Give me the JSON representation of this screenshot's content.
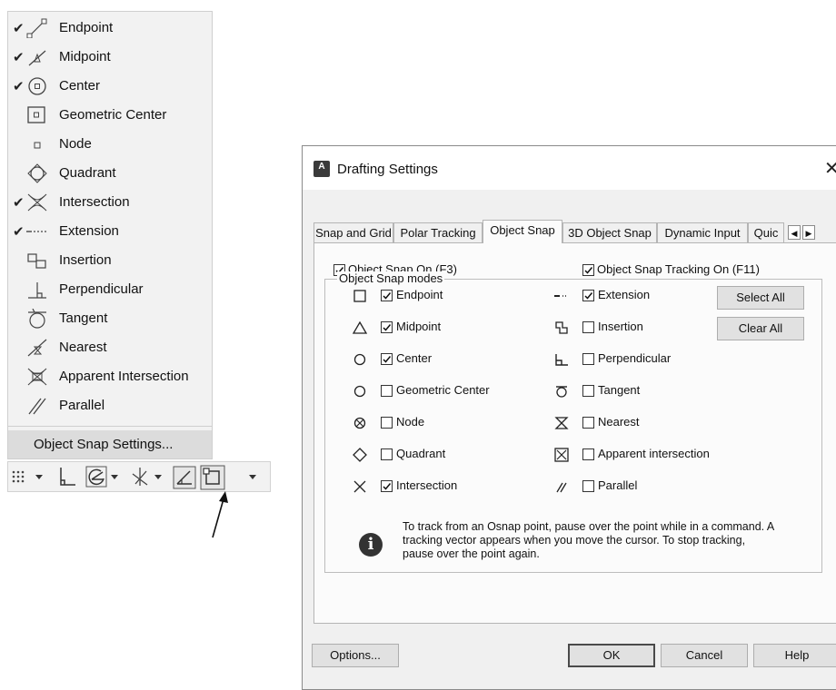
{
  "menu": {
    "items": [
      {
        "label": "Endpoint",
        "checked": true,
        "icon": "endpoint-icon"
      },
      {
        "label": "Midpoint",
        "checked": true,
        "icon": "midpoint-icon"
      },
      {
        "label": "Center",
        "checked": true,
        "icon": "center-icon"
      },
      {
        "label": "Geometric Center",
        "checked": false,
        "icon": "geometric-center-icon"
      },
      {
        "label": "Node",
        "checked": false,
        "icon": "node-icon"
      },
      {
        "label": "Quadrant",
        "checked": false,
        "icon": "quadrant-icon"
      },
      {
        "label": "Intersection",
        "checked": true,
        "icon": "intersection-icon"
      },
      {
        "label": "Extension",
        "checked": true,
        "icon": "extension-icon"
      },
      {
        "label": "Insertion",
        "checked": false,
        "icon": "insertion-icon"
      },
      {
        "label": "Perpendicular",
        "checked": false,
        "icon": "perpendicular-icon"
      },
      {
        "label": "Tangent",
        "checked": false,
        "icon": "tangent-icon"
      },
      {
        "label": "Nearest",
        "checked": false,
        "icon": "nearest-icon"
      },
      {
        "label": "Apparent Intersection",
        "checked": false,
        "icon": "apparent-intersection-icon"
      },
      {
        "label": "Parallel",
        "checked": false,
        "icon": "parallel-icon"
      }
    ],
    "settings_label": "Object Snap Settings...",
    "check_glyph": "✔"
  },
  "dialog": {
    "title": "Drafting Settings",
    "close": "✕",
    "app_icon": "A",
    "tabs": [
      "Snap and Grid",
      "Polar Tracking",
      "Object Snap",
      "3D Object Snap",
      "Dynamic Input",
      "Quic"
    ],
    "active_tab": "Object Snap",
    "osnap_on": {
      "label": "Object Snap On (F3)",
      "checked": true
    },
    "tracking_on": {
      "label": "Object Snap Tracking On (F11)",
      "checked": true
    },
    "group_title": "Object Snap modes",
    "modes_left": [
      {
        "label": "Endpoint",
        "checked": true
      },
      {
        "label": "Midpoint",
        "checked": true
      },
      {
        "label": "Center",
        "checked": true
      },
      {
        "label": "Geometric Center",
        "checked": false
      },
      {
        "label": "Node",
        "checked": false
      },
      {
        "label": "Quadrant",
        "checked": false
      },
      {
        "label": "Intersection",
        "checked": true
      }
    ],
    "modes_right": [
      {
        "label": "Extension",
        "checked": true
      },
      {
        "label": "Insertion",
        "checked": false
      },
      {
        "label": "Perpendicular",
        "checked": false
      },
      {
        "label": "Tangent",
        "checked": false
      },
      {
        "label": "Nearest",
        "checked": false
      },
      {
        "label": "Apparent intersection",
        "checked": false
      },
      {
        "label": "Parallel",
        "checked": false
      }
    ],
    "select_all": "Select All",
    "clear_all": "Clear All",
    "info": "To track from an Osnap point, pause over the point while in a command.  A tracking vector appears when you move the cursor.  To stop tracking, pause over the point again.",
    "info_icon": "i",
    "buttons": {
      "options": "Options...",
      "ok": "OK",
      "cancel": "Cancel",
      "help": "Help"
    }
  }
}
